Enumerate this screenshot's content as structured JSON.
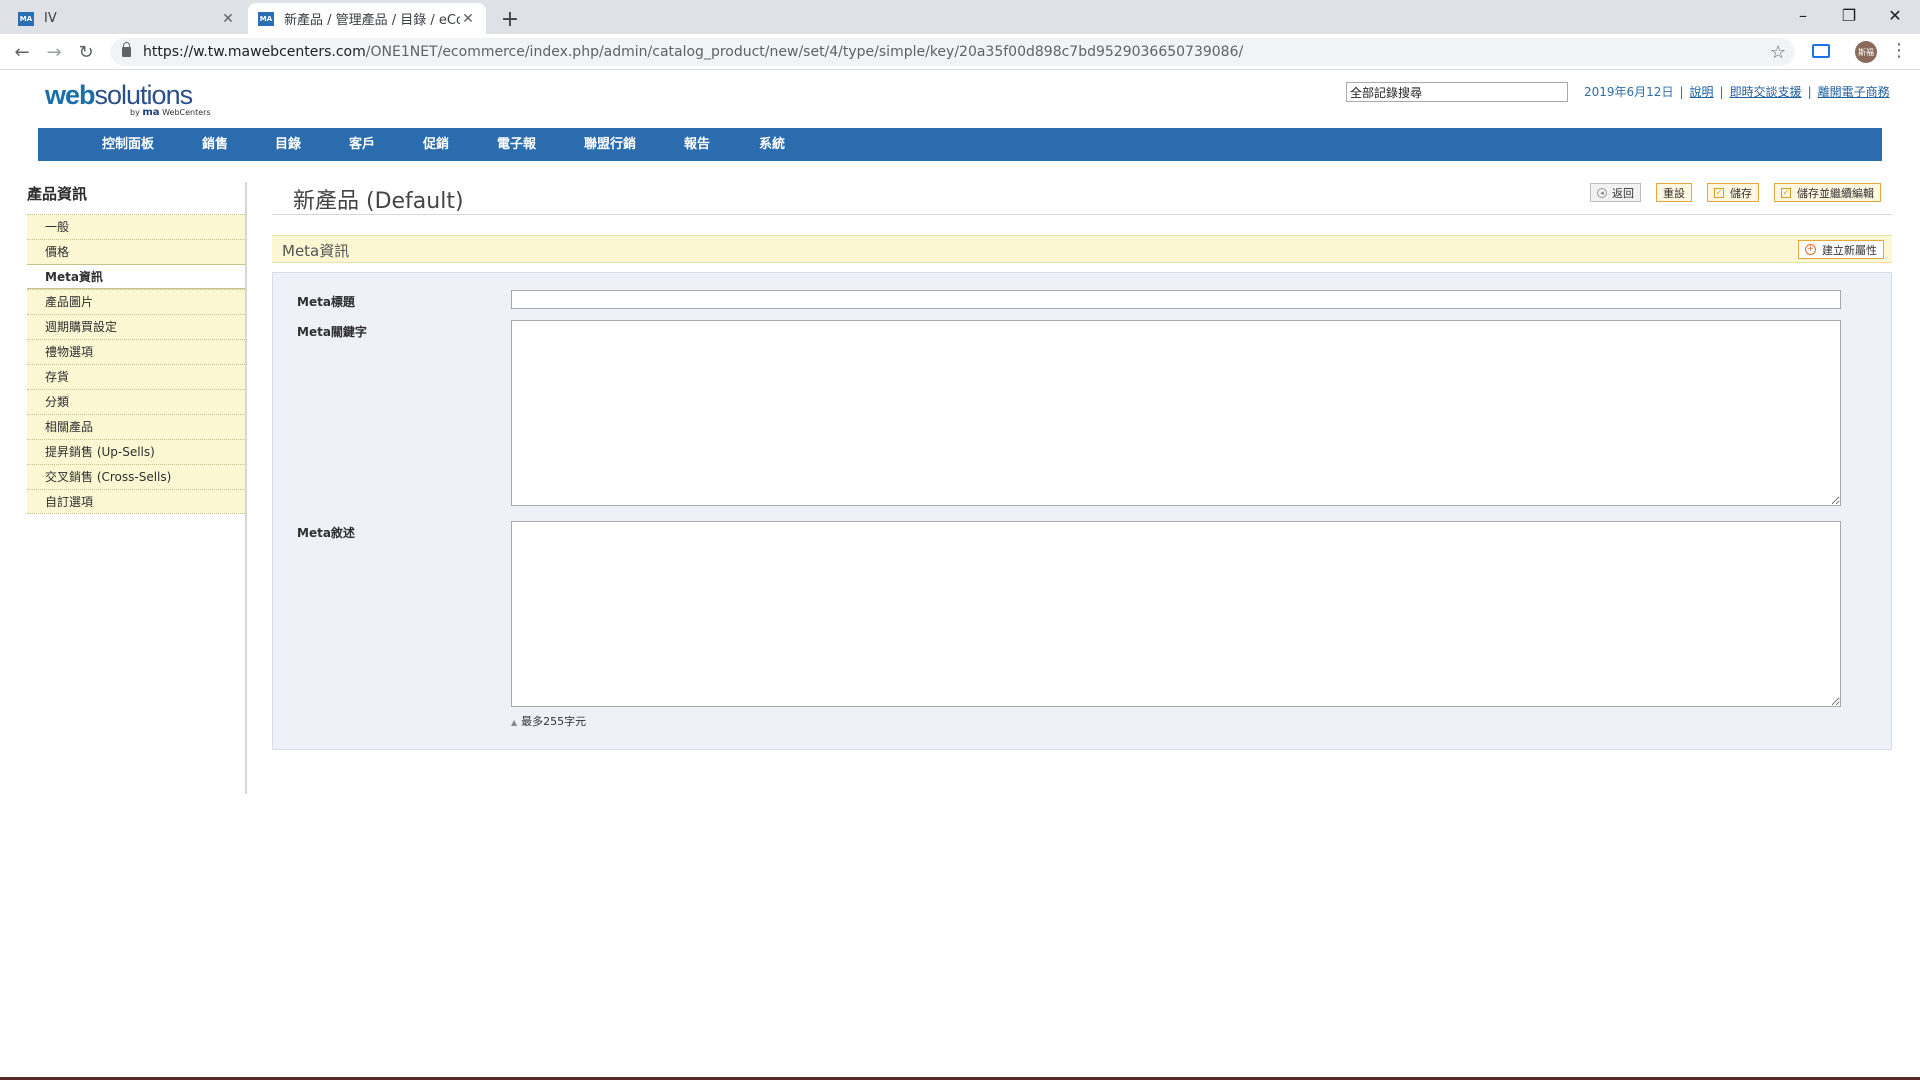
{
  "browser": {
    "tabs": [
      {
        "title": "IV",
        "favicon": "MA",
        "active": false
      },
      {
        "title": "新產品 / 管理產品 / 目錄 / eCom",
        "favicon": "MA",
        "active": true
      }
    ],
    "url_host": "https://w.tw.mawebcenters.com",
    "url_path": "/ONE1NET/ecommerce/index.php/admin/catalog_product/new/set/4/type/simple/key/20a35f00d898c7bd9529036650739086/",
    "profile_initials": "斯福"
  },
  "logo": {
    "main_bold": "web",
    "main_rest": "solutions",
    "sub_by": "by",
    "sub_brand": "ma",
    "sub_tail": "WebCenters"
  },
  "header": {
    "search_value": "全部記錄搜尋",
    "date": "2019年6月12日",
    "links": [
      "說明",
      "即時交談支援",
      "離開電子商務"
    ]
  },
  "nav": [
    "控制面板",
    "銷售",
    "目錄",
    "客戶",
    "促銷",
    "電子報",
    "聯盟行銷",
    "報告",
    "系統"
  ],
  "sidebar": {
    "title": "產品資訊",
    "items": [
      "一般",
      "價格",
      "Meta資訊",
      "產品圖片",
      "週期購買設定",
      "禮物選項",
      "存貨",
      "分類",
      "相關產品",
      "提昇銷售 (Up-Sells)",
      "交叉銷售 (Cross-Sells)",
      "自訂選項"
    ],
    "active_index": 2
  },
  "page": {
    "title": "新產品 (Default)",
    "buttons": {
      "back": "返回",
      "reset": "重設",
      "save": "儲存",
      "save_continue": "儲存並繼續編輯"
    }
  },
  "section": {
    "title": "Meta資訊",
    "new_attribute": "建立新屬性",
    "fields": {
      "meta_title": "Meta標題",
      "meta_keywords": "Meta關鍵字",
      "meta_description": "Meta敘述"
    },
    "note": "最多255字元"
  },
  "colors": {
    "nav": "#2a6cae",
    "sidebar_item": "#fbf7d3",
    "fieldset": "#eef1f8",
    "button_border": "#e8a73a"
  }
}
